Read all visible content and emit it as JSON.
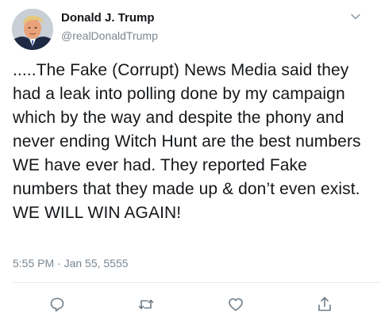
{
  "author": {
    "name": "Donald J. Trump",
    "handle": "@realDonaldTrump"
  },
  "tweet": {
    "text": ".....The Fake (Corrupt) News Media said they had a leak into polling done by my campaign which by the way and despite the phony and never ending Witch Hunt are the best numbers WE have ever had. They reported Fake numbers that they made up & don’t even exist. WE WILL WIN AGAIN!",
    "timestamp": "5:55 PM · Jan 55, 5555"
  },
  "icons": {
    "menu": "chevron-down-icon",
    "reply": "reply-icon",
    "retweet": "retweet-icon",
    "like": "heart-icon",
    "share": "share-icon"
  },
  "colors": {
    "text": "#14171a",
    "secondary": "#7b8690",
    "divider": "#e6ecf0",
    "action_icon": "#6e7b86"
  }
}
